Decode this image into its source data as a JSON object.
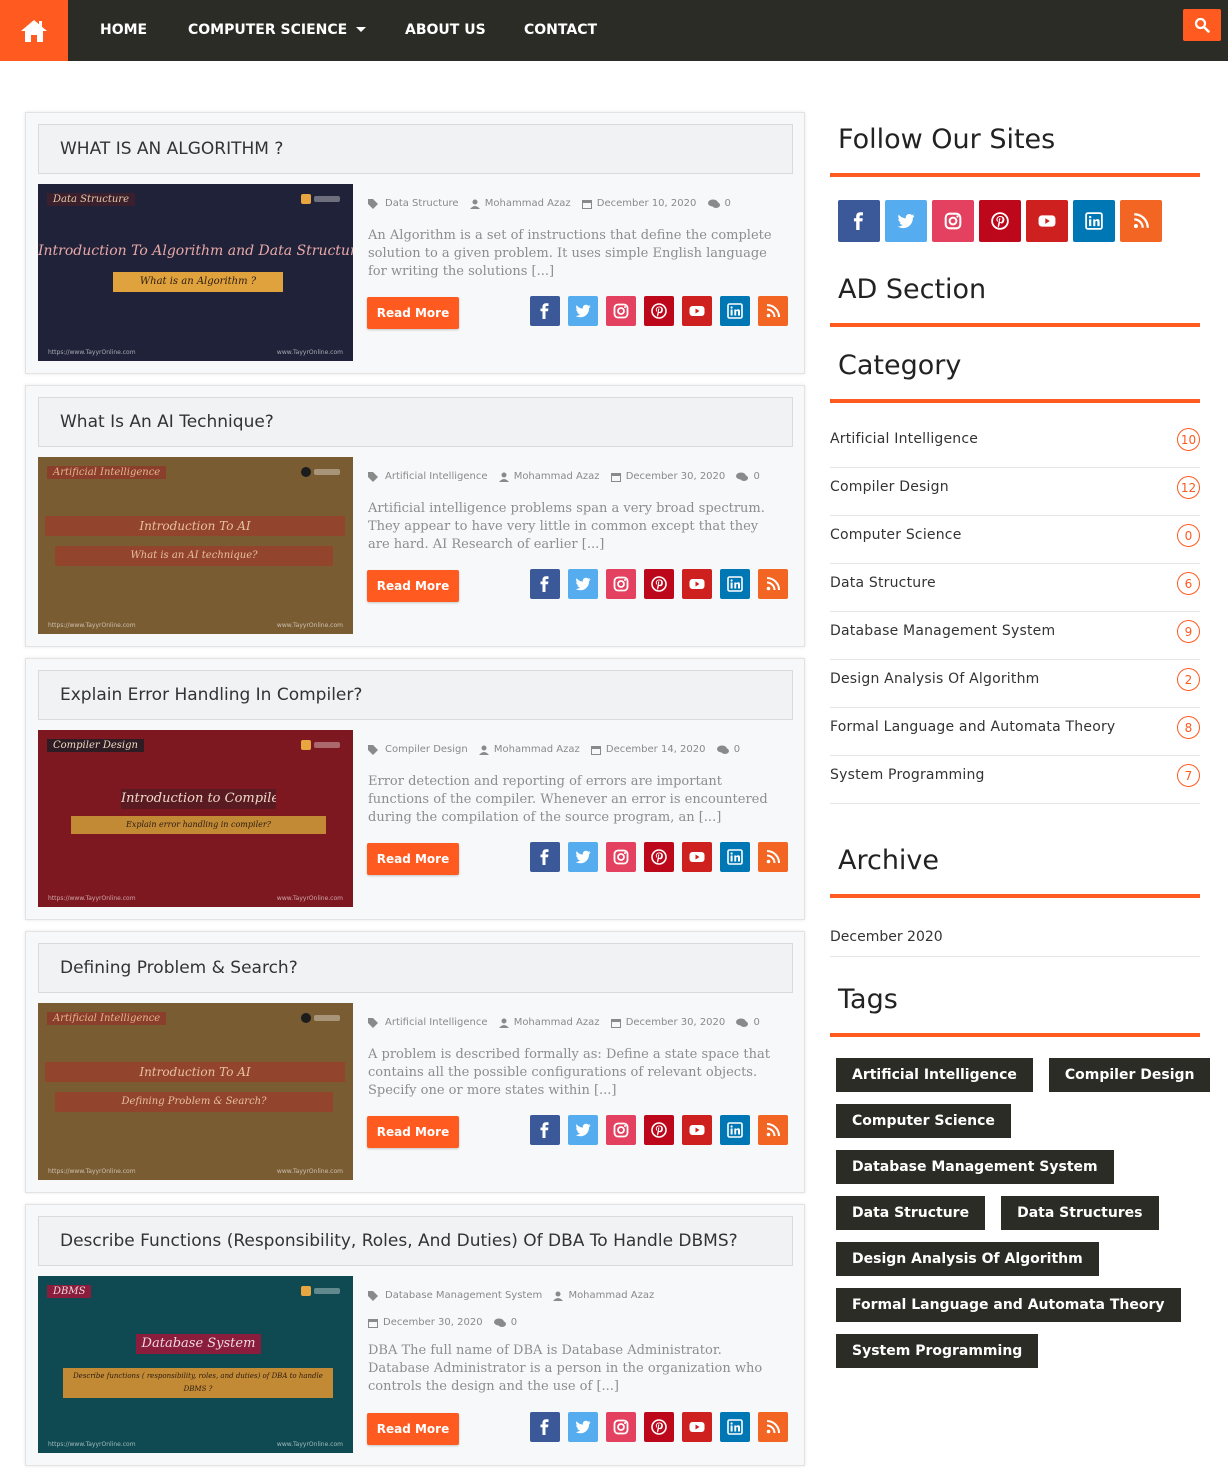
{
  "nav": {
    "home_icon": "home-icon",
    "items": [
      {
        "label": "HOME"
      },
      {
        "label": "COMPUTER SCIENCE",
        "has_dropdown": true
      },
      {
        "label": "ABOUT US"
      },
      {
        "label": "CONTACT"
      }
    ],
    "search_icon": "search-icon"
  },
  "colors": {
    "accent": "#ff5a1f",
    "nav_bg": "#2c2c26",
    "facebook": "#3b5998",
    "twitter": "#55acee",
    "instagram": "#e4405f",
    "pinterest": "#bd081c",
    "youtube": "#cd201f",
    "linkedin": "#0077b5",
    "rss": "#f26522"
  },
  "posts": [
    {
      "title": "WHAT IS AN ALGORITHM ?",
      "category": "Data Structure",
      "author": "Mohammad Azaz",
      "date": "December 10, 2020",
      "comments": "0",
      "excerpt": "An Algorithm is a set of instructions that define the complete solution to a given problem. It uses simple English language for writing the solutions [...]",
      "read_more": "Read More",
      "thumb": {
        "tag": "Data Structure",
        "heading": "Introduction To Algorithm and Data Structures",
        "band": "What is an Algorithm ?",
        "footer_left": "https://www.TayyrOnline.com",
        "footer_right": "www.TayyrOnline.com"
      }
    },
    {
      "title": "What Is An AI Technique?",
      "category": "Artificial Intelligence",
      "author": "Mohammad Azaz",
      "date": "December 30, 2020",
      "comments": "0",
      "excerpt": "Artificial intelligence problems span a very broad spectrum. They appear to have very little in common except that they are hard. AI Research of earlier [...]",
      "read_more": "Read More",
      "thumb": {
        "tag": "Artificial Intelligence",
        "heading": "Introduction To AI",
        "band": "What is an AI technique?",
        "footer_left": "https://www.TayyrOnline.com",
        "footer_right": "www.TayyrOnline.com"
      }
    },
    {
      "title": "Explain Error Handling In Compiler?",
      "category": "Compiler Design",
      "author": "Mohammad Azaz",
      "date": "December 14, 2020",
      "comments": "0",
      "excerpt": "Error detection and reporting of errors are important functions of the compiler. Whenever an error is encountered during the compilation of the source program, an [...]",
      "read_more": "Read More",
      "thumb": {
        "tag": "Compiler Design",
        "heading": "Introduction to Compiler",
        "band": "Explain error handling in compiler?",
        "footer_left": "https://www.TayyrOnline.com",
        "footer_right": "www.TayyrOnline.com"
      }
    },
    {
      "title": "Defining Problem & Search?",
      "category": "Artificial Intelligence",
      "author": "Mohammad Azaz",
      "date": "December 30, 2020",
      "comments": "0",
      "excerpt": "A problem is described formally as: Define a state space that contains all the possible configurations of relevant objects. Specify one or more states within [...]",
      "read_more": "Read More",
      "thumb": {
        "tag": "Artificial Intelligence",
        "heading": "Introduction To AI",
        "band": "Defining Problem & Search?",
        "footer_left": "https://www.TayyrOnline.com",
        "footer_right": "www.TayyrOnline.com"
      }
    },
    {
      "title": "Describe Functions (Responsibility, Roles, And Duties) Of DBA To Handle DBMS?",
      "category": "Database Management System",
      "author": "Mohammad Azaz",
      "date": "December 30, 2020",
      "comments": "0",
      "excerpt": "DBA The full name of DBA is Database Administrator. Database Administrator is a person in the organization who controls the design and the use of [...]",
      "read_more": "Read More",
      "thumb": {
        "tag": "DBMS",
        "heading": "Database System",
        "band": "Describe functions ( responsibility, roles, and duties) of DBA to handle DBMS ?",
        "footer_left": "https://www.TayyrOnline.com",
        "footer_right": "www.TayyrOnline.com"
      }
    }
  ],
  "share_icons": [
    "facebook-icon",
    "twitter-icon",
    "instagram-icon",
    "pinterest-icon",
    "youtube-icon",
    "linkedin-icon",
    "rss-icon"
  ],
  "sidebar": {
    "follow_title": "Follow Our Sites",
    "ad_title": "AD Section",
    "category_title": "Category",
    "categories": [
      {
        "name": "Artificial Intelligence",
        "count": "10"
      },
      {
        "name": "Compiler Design",
        "count": "12"
      },
      {
        "name": "Computer Science",
        "count": "0"
      },
      {
        "name": "Data Structure",
        "count": "6"
      },
      {
        "name": "Database Management System",
        "count": "9"
      },
      {
        "name": "Design Analysis Of Algorithm",
        "count": "2"
      },
      {
        "name": "Formal Language and Automata Theory",
        "count": "8"
      },
      {
        "name": "System Programming",
        "count": "7"
      }
    ],
    "archive_title": "Archive",
    "archive_items": [
      "December 2020"
    ],
    "tags_title": "Tags",
    "tags": [
      "Artificial Intelligence",
      "Compiler Design",
      "Computer Science",
      "Database Management System",
      "Data Structure",
      "Data Structures",
      "Design Analysis Of Algorithm",
      "Formal Language and Automata Theory",
      "System Programming"
    ]
  }
}
